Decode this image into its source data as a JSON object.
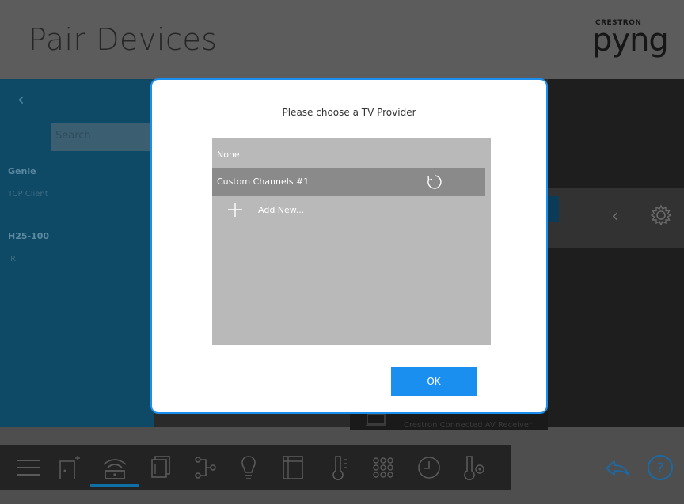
{
  "app": {
    "title": "Pair Devices",
    "brand_small": "CRESTRON",
    "brand_name": "pyng"
  },
  "sidebar": {
    "back_icon": "chevron-left-icon",
    "search_placeholder": "Search",
    "devices": [
      {
        "name": "Genie",
        "type": "TCP Client"
      },
      {
        "name": "H25-100",
        "type": "IR"
      }
    ]
  },
  "background_device": {
    "label": "Crestron Connected AV Receiver"
  },
  "modal": {
    "title": "Please choose a TV Provider",
    "items": [
      {
        "label": "None"
      },
      {
        "label": "Custom Channels #1",
        "icon": "refresh-icon"
      }
    ],
    "add_new_label": "Add New...",
    "ok_label": "OK"
  },
  "toolbar": {
    "icons": [
      "menu-icon",
      "add-device-icon",
      "gateway-icon",
      "shades-icon",
      "scenes-icon",
      "lighting-icon",
      "window-icon",
      "thermostat-icon",
      "keypad-icon",
      "clock-icon",
      "temperature-sensor-icon"
    ],
    "active_index": 2,
    "right_icons": [
      "share-back-icon",
      "help-icon"
    ]
  },
  "colors": {
    "accent": "#1a8ff0",
    "sidebar": "#0e4a66",
    "list_bg": "#b9b9b9",
    "selected_item": "#8a8a8a"
  }
}
